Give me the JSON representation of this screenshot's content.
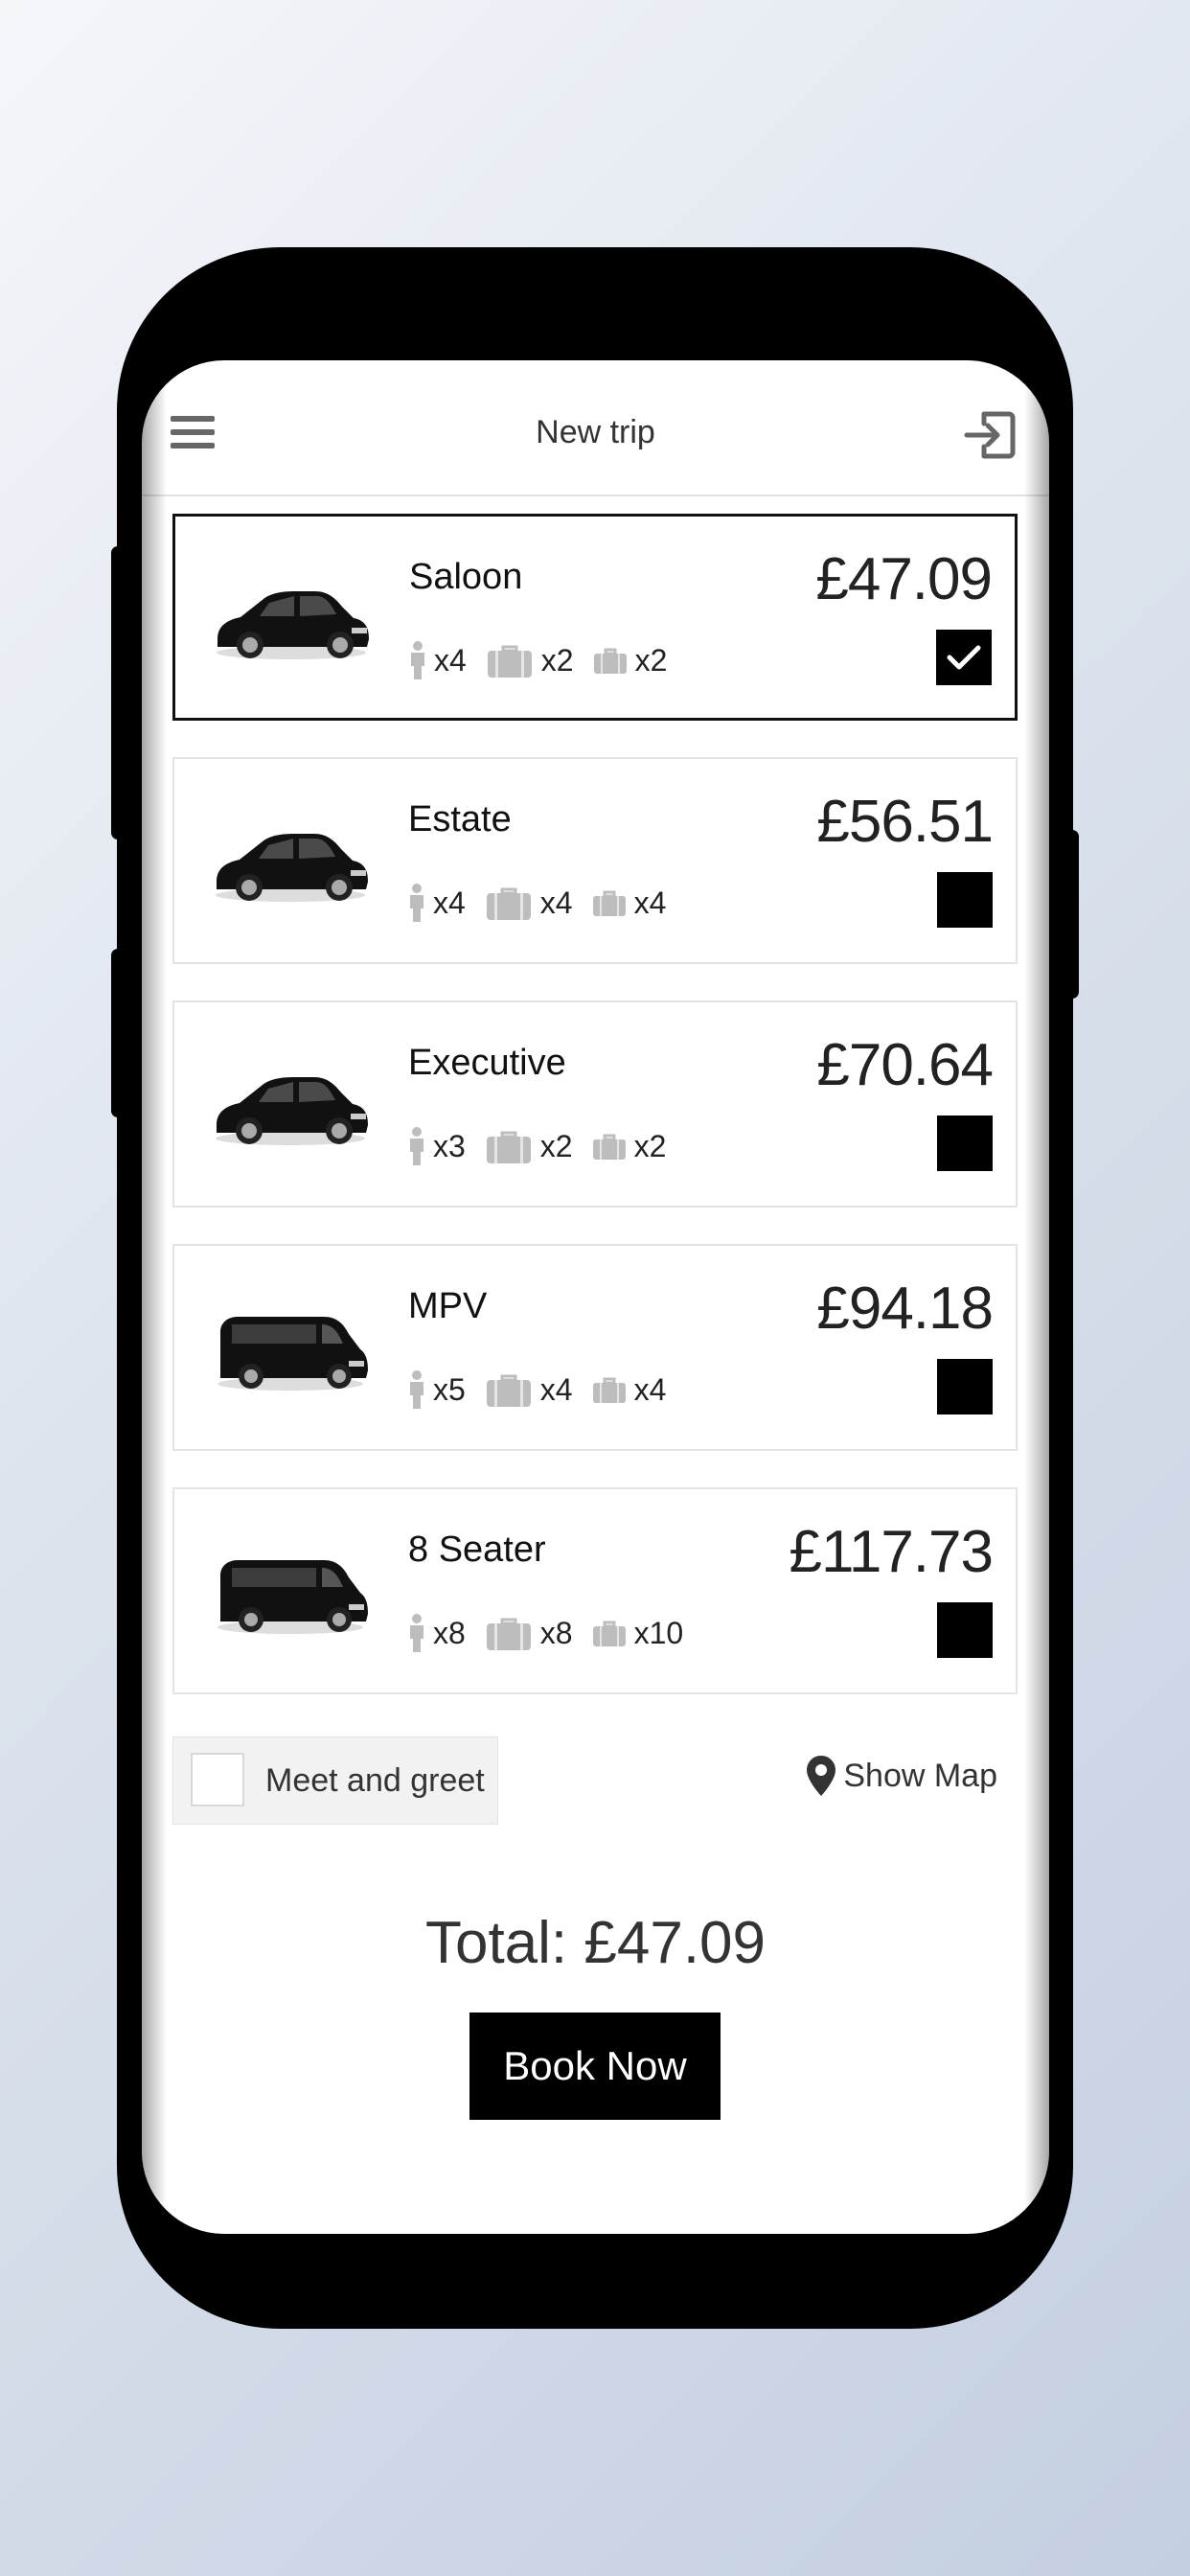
{
  "header": {
    "title": "New trip"
  },
  "vehicles": [
    {
      "name": "Saloon",
      "price": "£47.09",
      "passengers": "x4",
      "large_bags": "x2",
      "small_bags": "x2",
      "selected": true,
      "car_icon": "saloon-car-image"
    },
    {
      "name": "Estate",
      "price": "£56.51",
      "passengers": "x4",
      "large_bags": "x4",
      "small_bags": "x4",
      "selected": false,
      "car_icon": "estate-car-image"
    },
    {
      "name": "Executive",
      "price": "£70.64",
      "passengers": "x3",
      "large_bags": "x2",
      "small_bags": "x2",
      "selected": false,
      "car_icon": "executive-car-image"
    },
    {
      "name": "MPV",
      "price": "£94.18",
      "passengers": "x5",
      "large_bags": "x4",
      "small_bags": "x4",
      "selected": false,
      "car_icon": "mpv-van-image"
    },
    {
      "name": "8 Seater",
      "price": "£117.73",
      "passengers": "x8",
      "large_bags": "x8",
      "small_bags": "x10",
      "selected": false,
      "car_icon": "minibus-image"
    }
  ],
  "options": {
    "meet_and_greet_label": "Meet and greet",
    "meet_and_greet_checked": false,
    "show_map_label": "Show Map"
  },
  "summary": {
    "total": "Total: £47.09",
    "book_label": "Book Now"
  },
  "colors": {
    "accent": "#000000",
    "icon_grey": "#bdbdbd",
    "card_border": "#e4e4e4"
  }
}
